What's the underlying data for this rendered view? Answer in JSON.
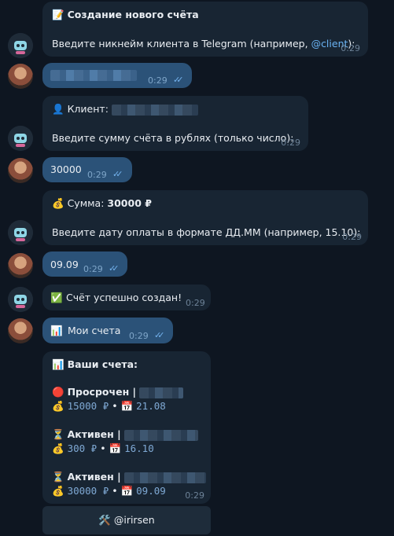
{
  "messages": {
    "m1": {
      "title": "Создание нового счёта",
      "text_pre": "Введите никнейм клиента в Telegram (например, ",
      "link": "@client",
      "text_post": "):",
      "time": "0:29"
    },
    "m2": {
      "time": "0:29"
    },
    "m3": {
      "label": "Клиент:",
      "text": "Введите сумму счёта в рублях (только число):",
      "time": "0:29"
    },
    "m4": {
      "text": "30000",
      "time": "0:29"
    },
    "m5": {
      "label": "Сумма:",
      "amount": "30000 ₽",
      "text": "Введите дату оплаты в формате ДД.ММ (например, 15.10):",
      "time": "0:29"
    },
    "m6": {
      "text": "09.09",
      "time": "0:29"
    },
    "m7": {
      "text": "Счёт успешно создан!",
      "time": "0:29"
    },
    "m8": {
      "text": "Мои счета",
      "time": "0:29"
    },
    "m9": {
      "title": "Ваши счета:",
      "time": "0:29",
      "entries": [
        {
          "status": "Просрочен |",
          "amount": "15000 ₽",
          "sep": "•",
          "date": "21.08"
        },
        {
          "status": "Активен |",
          "amount": "300 ₽",
          "sep": "•",
          "date": "16.10"
        },
        {
          "status": "Активен |",
          "amount": "30000 ₽",
          "sep": "•",
          "date": "09.09"
        }
      ]
    }
  },
  "keyboard": {
    "button_label": "@irirsen"
  },
  "colors": {
    "background": "#0e1621",
    "incoming": "#182533",
    "outgoing": "#2b5278",
    "link": "#6ab3f3"
  }
}
